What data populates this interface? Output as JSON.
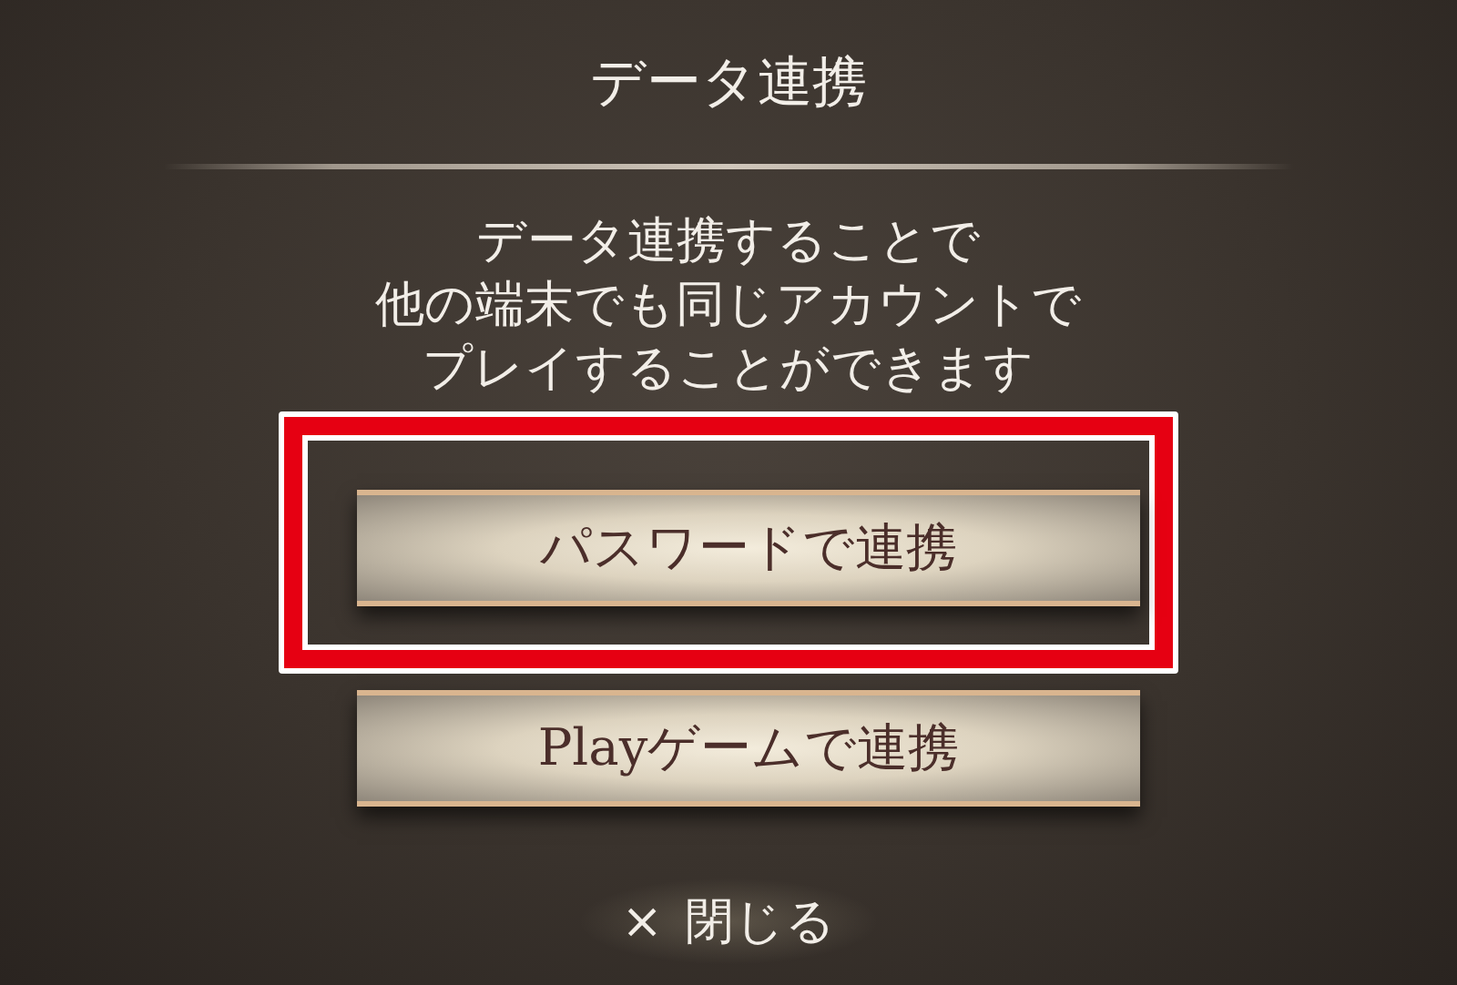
{
  "dialog": {
    "title": "データ連携",
    "message": [
      "データ連携することで",
      "他の端末でも同じアカウントで",
      "プレイすることができます"
    ],
    "buttons": [
      {
        "label": "パスワードで連携",
        "highlighted": true
      },
      {
        "label": "Playゲームで連携",
        "highlighted": false
      }
    ],
    "close": {
      "icon": "×",
      "label": "閉じる"
    }
  }
}
